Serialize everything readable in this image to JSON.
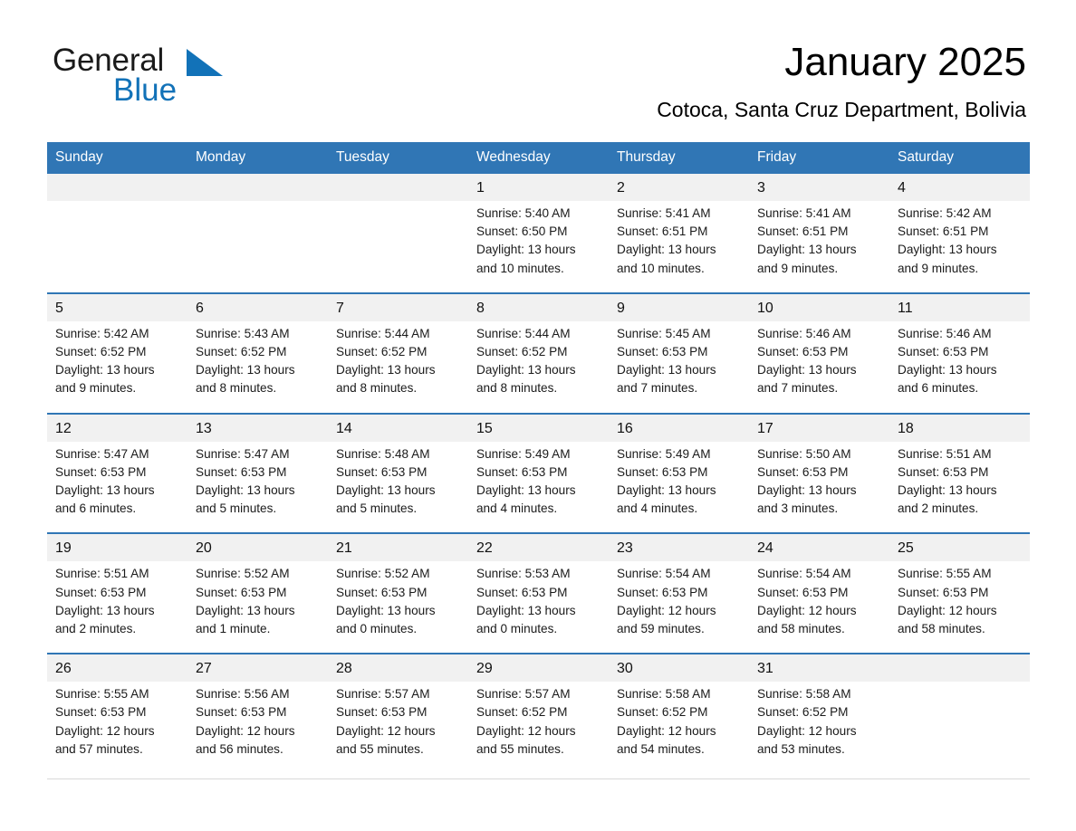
{
  "brand": {
    "name_part1": "General",
    "name_part2": "Blue",
    "triangle_color": "#1272b8"
  },
  "header": {
    "title": "January 2025",
    "subtitle": "Cotoca, Santa Cruz Department, Bolivia"
  },
  "theme": {
    "header_blue": "#3076b5",
    "daynum_bg": "#f1f1f1",
    "text": "#1a1a1a"
  },
  "calendar": {
    "weekday_headers": [
      "Sunday",
      "Monday",
      "Tuesday",
      "Wednesday",
      "Thursday",
      "Friday",
      "Saturday"
    ],
    "weeks": [
      {
        "days": [
          {
            "num": "",
            "sunrise": "",
            "sunset": "",
            "daylight1": "",
            "daylight2": ""
          },
          {
            "num": "",
            "sunrise": "",
            "sunset": "",
            "daylight1": "",
            "daylight2": ""
          },
          {
            "num": "",
            "sunrise": "",
            "sunset": "",
            "daylight1": "",
            "daylight2": ""
          },
          {
            "num": "1",
            "sunrise": "Sunrise: 5:40 AM",
            "sunset": "Sunset: 6:50 PM",
            "daylight1": "Daylight: 13 hours",
            "daylight2": "and 10 minutes."
          },
          {
            "num": "2",
            "sunrise": "Sunrise: 5:41 AM",
            "sunset": "Sunset: 6:51 PM",
            "daylight1": "Daylight: 13 hours",
            "daylight2": "and 10 minutes."
          },
          {
            "num": "3",
            "sunrise": "Sunrise: 5:41 AM",
            "sunset": "Sunset: 6:51 PM",
            "daylight1": "Daylight: 13 hours",
            "daylight2": "and 9 minutes."
          },
          {
            "num": "4",
            "sunrise": "Sunrise: 5:42 AM",
            "sunset": "Sunset: 6:51 PM",
            "daylight1": "Daylight: 13 hours",
            "daylight2": "and 9 minutes."
          }
        ]
      },
      {
        "days": [
          {
            "num": "5",
            "sunrise": "Sunrise: 5:42 AM",
            "sunset": "Sunset: 6:52 PM",
            "daylight1": "Daylight: 13 hours",
            "daylight2": "and 9 minutes."
          },
          {
            "num": "6",
            "sunrise": "Sunrise: 5:43 AM",
            "sunset": "Sunset: 6:52 PM",
            "daylight1": "Daylight: 13 hours",
            "daylight2": "and 8 minutes."
          },
          {
            "num": "7",
            "sunrise": "Sunrise: 5:44 AM",
            "sunset": "Sunset: 6:52 PM",
            "daylight1": "Daylight: 13 hours",
            "daylight2": "and 8 minutes."
          },
          {
            "num": "8",
            "sunrise": "Sunrise: 5:44 AM",
            "sunset": "Sunset: 6:52 PM",
            "daylight1": "Daylight: 13 hours",
            "daylight2": "and 8 minutes."
          },
          {
            "num": "9",
            "sunrise": "Sunrise: 5:45 AM",
            "sunset": "Sunset: 6:53 PM",
            "daylight1": "Daylight: 13 hours",
            "daylight2": "and 7 minutes."
          },
          {
            "num": "10",
            "sunrise": "Sunrise: 5:46 AM",
            "sunset": "Sunset: 6:53 PM",
            "daylight1": "Daylight: 13 hours",
            "daylight2": "and 7 minutes."
          },
          {
            "num": "11",
            "sunrise": "Sunrise: 5:46 AM",
            "sunset": "Sunset: 6:53 PM",
            "daylight1": "Daylight: 13 hours",
            "daylight2": "and 6 minutes."
          }
        ]
      },
      {
        "days": [
          {
            "num": "12",
            "sunrise": "Sunrise: 5:47 AM",
            "sunset": "Sunset: 6:53 PM",
            "daylight1": "Daylight: 13 hours",
            "daylight2": "and 6 minutes."
          },
          {
            "num": "13",
            "sunrise": "Sunrise: 5:47 AM",
            "sunset": "Sunset: 6:53 PM",
            "daylight1": "Daylight: 13 hours",
            "daylight2": "and 5 minutes."
          },
          {
            "num": "14",
            "sunrise": "Sunrise: 5:48 AM",
            "sunset": "Sunset: 6:53 PM",
            "daylight1": "Daylight: 13 hours",
            "daylight2": "and 5 minutes."
          },
          {
            "num": "15",
            "sunrise": "Sunrise: 5:49 AM",
            "sunset": "Sunset: 6:53 PM",
            "daylight1": "Daylight: 13 hours",
            "daylight2": "and 4 minutes."
          },
          {
            "num": "16",
            "sunrise": "Sunrise: 5:49 AM",
            "sunset": "Sunset: 6:53 PM",
            "daylight1": "Daylight: 13 hours",
            "daylight2": "and 4 minutes."
          },
          {
            "num": "17",
            "sunrise": "Sunrise: 5:50 AM",
            "sunset": "Sunset: 6:53 PM",
            "daylight1": "Daylight: 13 hours",
            "daylight2": "and 3 minutes."
          },
          {
            "num": "18",
            "sunrise": "Sunrise: 5:51 AM",
            "sunset": "Sunset: 6:53 PM",
            "daylight1": "Daylight: 13 hours",
            "daylight2": "and 2 minutes."
          }
        ]
      },
      {
        "days": [
          {
            "num": "19",
            "sunrise": "Sunrise: 5:51 AM",
            "sunset": "Sunset: 6:53 PM",
            "daylight1": "Daylight: 13 hours",
            "daylight2": "and 2 minutes."
          },
          {
            "num": "20",
            "sunrise": "Sunrise: 5:52 AM",
            "sunset": "Sunset: 6:53 PM",
            "daylight1": "Daylight: 13 hours",
            "daylight2": "and 1 minute."
          },
          {
            "num": "21",
            "sunrise": "Sunrise: 5:52 AM",
            "sunset": "Sunset: 6:53 PM",
            "daylight1": "Daylight: 13 hours",
            "daylight2": "and 0 minutes."
          },
          {
            "num": "22",
            "sunrise": "Sunrise: 5:53 AM",
            "sunset": "Sunset: 6:53 PM",
            "daylight1": "Daylight: 13 hours",
            "daylight2": "and 0 minutes."
          },
          {
            "num": "23",
            "sunrise": "Sunrise: 5:54 AM",
            "sunset": "Sunset: 6:53 PM",
            "daylight1": "Daylight: 12 hours",
            "daylight2": "and 59 minutes."
          },
          {
            "num": "24",
            "sunrise": "Sunrise: 5:54 AM",
            "sunset": "Sunset: 6:53 PM",
            "daylight1": "Daylight: 12 hours",
            "daylight2": "and 58 minutes."
          },
          {
            "num": "25",
            "sunrise": "Sunrise: 5:55 AM",
            "sunset": "Sunset: 6:53 PM",
            "daylight1": "Daylight: 12 hours",
            "daylight2": "and 58 minutes."
          }
        ]
      },
      {
        "days": [
          {
            "num": "26",
            "sunrise": "Sunrise: 5:55 AM",
            "sunset": "Sunset: 6:53 PM",
            "daylight1": "Daylight: 12 hours",
            "daylight2": "and 57 minutes."
          },
          {
            "num": "27",
            "sunrise": "Sunrise: 5:56 AM",
            "sunset": "Sunset: 6:53 PM",
            "daylight1": "Daylight: 12 hours",
            "daylight2": "and 56 minutes."
          },
          {
            "num": "28",
            "sunrise": "Sunrise: 5:57 AM",
            "sunset": "Sunset: 6:53 PM",
            "daylight1": "Daylight: 12 hours",
            "daylight2": "and 55 minutes."
          },
          {
            "num": "29",
            "sunrise": "Sunrise: 5:57 AM",
            "sunset": "Sunset: 6:52 PM",
            "daylight1": "Daylight: 12 hours",
            "daylight2": "and 55 minutes."
          },
          {
            "num": "30",
            "sunrise": "Sunrise: 5:58 AM",
            "sunset": "Sunset: 6:52 PM",
            "daylight1": "Daylight: 12 hours",
            "daylight2": "and 54 minutes."
          },
          {
            "num": "31",
            "sunrise": "Sunrise: 5:58 AM",
            "sunset": "Sunset: 6:52 PM",
            "daylight1": "Daylight: 12 hours",
            "daylight2": "and 53 minutes."
          },
          {
            "num": "",
            "sunrise": "",
            "sunset": "",
            "daylight1": "",
            "daylight2": ""
          }
        ]
      }
    ]
  }
}
